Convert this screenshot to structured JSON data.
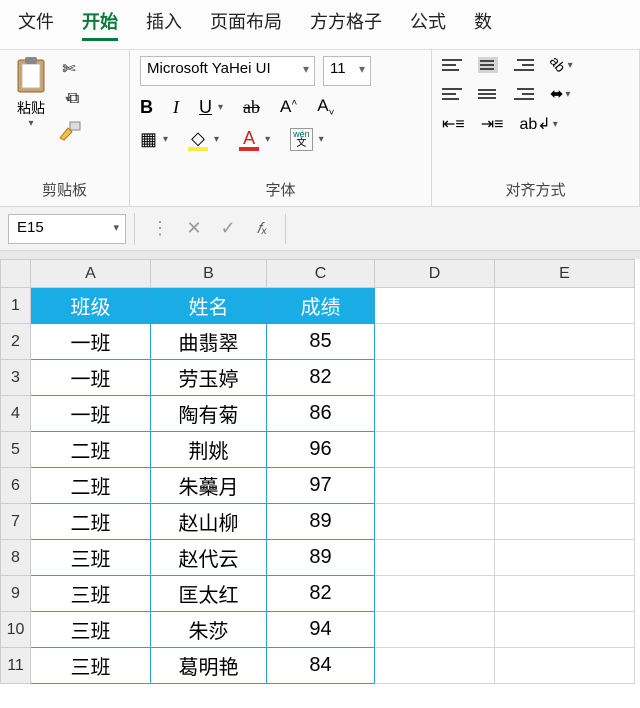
{
  "menu": {
    "file": "文件",
    "home": "开始",
    "insert": "插入",
    "layout": "页面布局",
    "fang": "方方格子",
    "formula": "公式",
    "data": "数"
  },
  "ribbon": {
    "clipboard": {
      "paste": "粘贴",
      "group": "剪贴板"
    },
    "font": {
      "name": "Microsoft YaHei UI",
      "size": "11",
      "group": "字体",
      "wen": "wén",
      "wen_char": "文"
    },
    "align": {
      "group": "对齐方式"
    }
  },
  "namebox": "E15",
  "fx": "𝑓ₓ",
  "cols": [
    "A",
    "B",
    "C",
    "D",
    "E"
  ],
  "rows": [
    "1",
    "2",
    "3",
    "4",
    "5",
    "6",
    "7",
    "8",
    "9",
    "10",
    "11"
  ],
  "table": {
    "headers": {
      "class": "班级",
      "name": "姓名",
      "score": "成绩"
    },
    "data": [
      {
        "class": "一班",
        "name": "曲翡翠",
        "score": "85"
      },
      {
        "class": "一班",
        "name": "劳玉婷",
        "score": "82"
      },
      {
        "class": "一班",
        "name": "陶有菊",
        "score": "86"
      },
      {
        "class": "二班",
        "name": "荆姚",
        "score": "96"
      },
      {
        "class": "二班",
        "name": "朱蘽月",
        "score": "97"
      },
      {
        "class": "二班",
        "name": "赵山柳",
        "score": "89"
      },
      {
        "class": "三班",
        "name": "赵代云",
        "score": "89"
      },
      {
        "class": "三班",
        "name": "匡太红",
        "score": "82"
      },
      {
        "class": "三班",
        "name": "朱莎",
        "score": "94"
      },
      {
        "class": "三班",
        "name": "葛明艳",
        "score": "84"
      }
    ]
  },
  "chart_data": {
    "type": "table",
    "columns": [
      "班级",
      "姓名",
      "成绩"
    ],
    "rows": [
      [
        "一班",
        "曲翡翠",
        85
      ],
      [
        "一班",
        "劳玉婷",
        82
      ],
      [
        "一班",
        "陶有菊",
        86
      ],
      [
        "二班",
        "荆姚",
        96
      ],
      [
        "二班",
        "朱蘽月",
        97
      ],
      [
        "二班",
        "赵山柳",
        89
      ],
      [
        "三班",
        "赵代云",
        89
      ],
      [
        "三班",
        "匡太红",
        82
      ],
      [
        "三班",
        "朱莎",
        94
      ],
      [
        "三班",
        "葛明艳",
        84
      ]
    ]
  }
}
